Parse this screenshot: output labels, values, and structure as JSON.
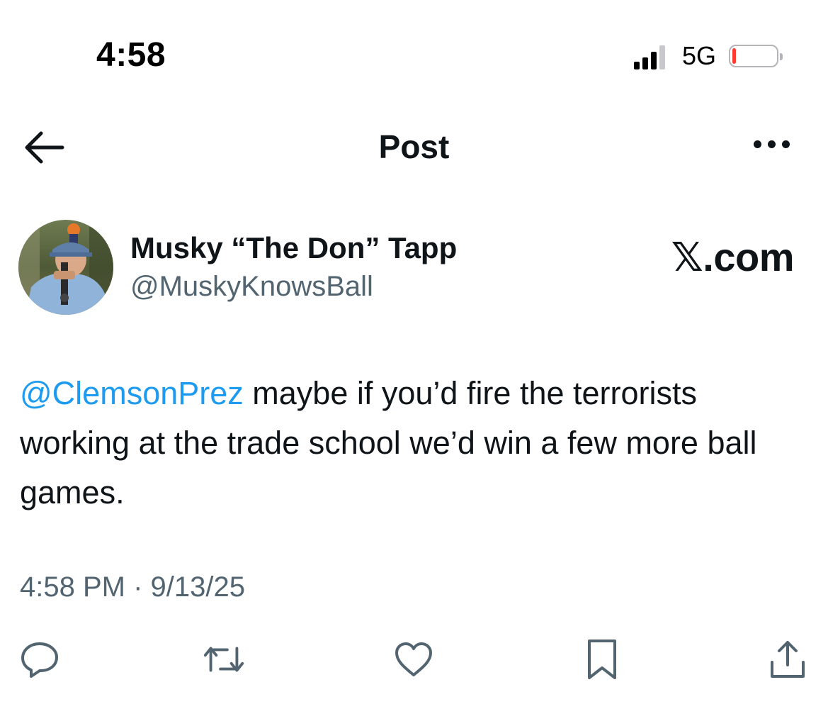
{
  "status_bar": {
    "time": "4:58",
    "network": "5G",
    "battery_level": 0.08,
    "battery_color": "#ff3b30"
  },
  "header": {
    "title": "Post",
    "back_icon": "arrow-left-icon",
    "more_icon": "more-horizontal-icon"
  },
  "author": {
    "name": "Musky “The Don” Tapp",
    "handle": "@MuskyKnowsBall",
    "source_label": "𝕏.com"
  },
  "tweet": {
    "mention": "@ClemsonPrez",
    "text": " maybe if you’d fire the terrorists working at the trade school we’d win a few more ball games.",
    "timestamp": "4:58 PM · 9/13/25"
  },
  "actions": [
    {
      "name": "reply",
      "icon": "reply-icon"
    },
    {
      "name": "repost",
      "icon": "repost-icon"
    },
    {
      "name": "like",
      "icon": "heart-icon"
    },
    {
      "name": "bookmark",
      "icon": "bookmark-icon"
    },
    {
      "name": "share",
      "icon": "share-icon"
    }
  ],
  "colors": {
    "text": "#0f1419",
    "secondary": "#536471",
    "link": "#1d9bf0"
  }
}
